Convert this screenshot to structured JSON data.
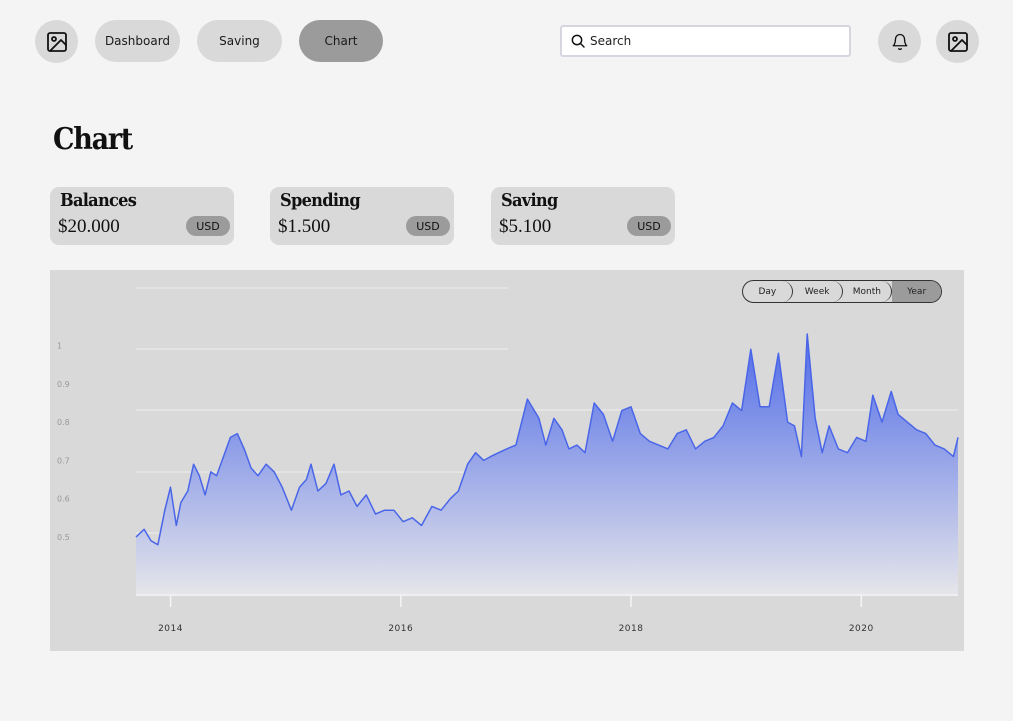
{
  "nav": {
    "items": [
      {
        "label": "Dashboard"
      },
      {
        "label": "Saving"
      },
      {
        "label": "Chart"
      }
    ],
    "active": "Chart"
  },
  "search": {
    "placeholder": "Search"
  },
  "icons": {
    "logo": "image-icon",
    "notifications": "bell-icon",
    "avatar": "image-icon"
  },
  "page": {
    "title": "Chart"
  },
  "cards": [
    {
      "label": "Balances",
      "value": "$20.000",
      "currency": "USD"
    },
    {
      "label": "Spending",
      "value": "$1.500",
      "currency": "USD"
    },
    {
      "label": "Saving",
      "value": "$5.100",
      "currency": "USD"
    }
  ],
  "range": {
    "options": [
      "Day",
      "Week",
      "Month",
      "Year"
    ],
    "selected": "Year"
  },
  "colors": {
    "accent": "#4a66e8",
    "fill_top": "#4a66e8",
    "fill_bottom": "#e6e6ea",
    "chart_bg": "#d9d9d9"
  },
  "chart_data": {
    "type": "area",
    "title": "",
    "xlabel": "",
    "ylabel": "",
    "y_ticks": [
      "0.5",
      "0.6",
      "0.7",
      "0.8",
      "0.9",
      "1"
    ],
    "x_ticks": [
      "2014",
      "2016",
      "2018",
      "2020"
    ],
    "ylim": [
      0.5,
      1
    ],
    "grid": true,
    "series": [
      {
        "x": [
          2013.7,
          2013.77,
          2013.83,
          2013.89,
          2013.95,
          2014.0,
          2014.05,
          2014.09,
          2014.15,
          2014.2,
          2014.25,
          2014.3,
          2014.35,
          2014.4,
          2014.46,
          2014.52,
          2014.58,
          2014.64,
          2014.7,
          2014.76,
          2014.83,
          2014.9,
          2014.97,
          2015.05,
          2015.12,
          2015.18,
          2015.22,
          2015.28,
          2015.35,
          2015.42,
          2015.48,
          2015.55,
          2015.62,
          2015.7,
          2015.78,
          2015.86,
          2015.94,
          2016.02,
          2016.1,
          2016.18,
          2016.27,
          2016.35,
          2016.43,
          2016.5,
          2016.58,
          2016.65,
          2016.72,
          2016.78,
          2016.85,
          2016.92,
          2017.0,
          2017.1,
          2017.2,
          2017.26,
          2017.33,
          2017.4,
          2017.46,
          2017.53,
          2017.6,
          2017.68,
          2017.76,
          2017.84,
          2017.92,
          2018.0,
          2018.08,
          2018.16,
          2018.24,
          2018.32,
          2018.4,
          2018.48,
          2018.56,
          2018.64,
          2018.72,
          2018.8,
          2018.88,
          2018.96,
          2019.04,
          2019.12,
          2019.2,
          2019.28,
          2019.36,
          2019.42,
          2019.48,
          2019.53,
          2019.6,
          2019.66,
          2019.72,
          2019.8,
          2019.88,
          2019.96,
          2020.04,
          2020.1,
          2020.18,
          2020.26,
          2020.32,
          2020.4,
          2020.48,
          2020.56,
          2020.64,
          2020.72,
          2020.8,
          2020.84
        ],
        "y": [
          0.5,
          0.52,
          0.49,
          0.48,
          0.57,
          0.63,
          0.53,
          0.59,
          0.62,
          0.69,
          0.66,
          0.61,
          0.67,
          0.66,
          0.71,
          0.76,
          0.77,
          0.73,
          0.68,
          0.66,
          0.69,
          0.67,
          0.63,
          0.57,
          0.63,
          0.65,
          0.69,
          0.62,
          0.64,
          0.69,
          0.61,
          0.62,
          0.58,
          0.61,
          0.56,
          0.57,
          0.57,
          0.54,
          0.55,
          0.53,
          0.58,
          0.57,
          0.6,
          0.62,
          0.69,
          0.72,
          0.7,
          0.71,
          0.72,
          0.73,
          0.74,
          0.86,
          0.81,
          0.74,
          0.81,
          0.78,
          0.73,
          0.74,
          0.72,
          0.85,
          0.82,
          0.75,
          0.83,
          0.84,
          0.77,
          0.75,
          0.74,
          0.73,
          0.77,
          0.78,
          0.73,
          0.75,
          0.76,
          0.79,
          0.85,
          0.83,
          0.99,
          0.84,
          0.84,
          0.98,
          0.8,
          0.79,
          0.71,
          1.03,
          0.81,
          0.72,
          0.79,
          0.73,
          0.72,
          0.76,
          0.75,
          0.87,
          0.8,
          0.88,
          0.82,
          0.8,
          0.78,
          0.77,
          0.74,
          0.73,
          0.71,
          0.76
        ]
      }
    ]
  }
}
